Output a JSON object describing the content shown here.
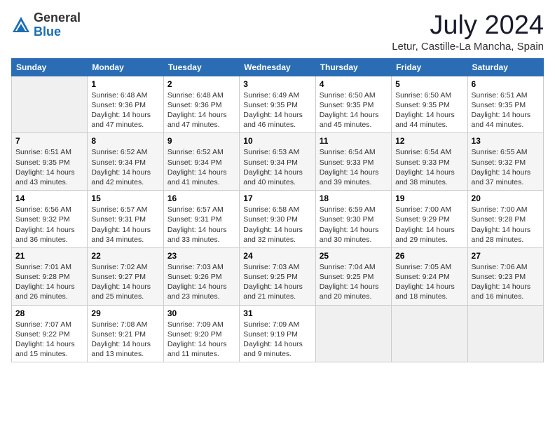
{
  "header": {
    "logo_general": "General",
    "logo_blue": "Blue",
    "month": "July 2024",
    "location": "Letur, Castille-La Mancha, Spain"
  },
  "days_of_week": [
    "Sunday",
    "Monday",
    "Tuesday",
    "Wednesday",
    "Thursday",
    "Friday",
    "Saturday"
  ],
  "weeks": [
    [
      {
        "day": "",
        "text": ""
      },
      {
        "day": "1",
        "text": "Sunrise: 6:48 AM\nSunset: 9:36 PM\nDaylight: 14 hours\nand 47 minutes."
      },
      {
        "day": "2",
        "text": "Sunrise: 6:48 AM\nSunset: 9:36 PM\nDaylight: 14 hours\nand 47 minutes."
      },
      {
        "day": "3",
        "text": "Sunrise: 6:49 AM\nSunset: 9:35 PM\nDaylight: 14 hours\nand 46 minutes."
      },
      {
        "day": "4",
        "text": "Sunrise: 6:50 AM\nSunset: 9:35 PM\nDaylight: 14 hours\nand 45 minutes."
      },
      {
        "day": "5",
        "text": "Sunrise: 6:50 AM\nSunset: 9:35 PM\nDaylight: 14 hours\nand 44 minutes."
      },
      {
        "day": "6",
        "text": "Sunrise: 6:51 AM\nSunset: 9:35 PM\nDaylight: 14 hours\nand 44 minutes."
      }
    ],
    [
      {
        "day": "7",
        "text": "Sunrise: 6:51 AM\nSunset: 9:35 PM\nDaylight: 14 hours\nand 43 minutes."
      },
      {
        "day": "8",
        "text": "Sunrise: 6:52 AM\nSunset: 9:34 PM\nDaylight: 14 hours\nand 42 minutes."
      },
      {
        "day": "9",
        "text": "Sunrise: 6:52 AM\nSunset: 9:34 PM\nDaylight: 14 hours\nand 41 minutes."
      },
      {
        "day": "10",
        "text": "Sunrise: 6:53 AM\nSunset: 9:34 PM\nDaylight: 14 hours\nand 40 minutes."
      },
      {
        "day": "11",
        "text": "Sunrise: 6:54 AM\nSunset: 9:33 PM\nDaylight: 14 hours\nand 39 minutes."
      },
      {
        "day": "12",
        "text": "Sunrise: 6:54 AM\nSunset: 9:33 PM\nDaylight: 14 hours\nand 38 minutes."
      },
      {
        "day": "13",
        "text": "Sunrise: 6:55 AM\nSunset: 9:32 PM\nDaylight: 14 hours\nand 37 minutes."
      }
    ],
    [
      {
        "day": "14",
        "text": "Sunrise: 6:56 AM\nSunset: 9:32 PM\nDaylight: 14 hours\nand 36 minutes."
      },
      {
        "day": "15",
        "text": "Sunrise: 6:57 AM\nSunset: 9:31 PM\nDaylight: 14 hours\nand 34 minutes."
      },
      {
        "day": "16",
        "text": "Sunrise: 6:57 AM\nSunset: 9:31 PM\nDaylight: 14 hours\nand 33 minutes."
      },
      {
        "day": "17",
        "text": "Sunrise: 6:58 AM\nSunset: 9:30 PM\nDaylight: 14 hours\nand 32 minutes."
      },
      {
        "day": "18",
        "text": "Sunrise: 6:59 AM\nSunset: 9:30 PM\nDaylight: 14 hours\nand 30 minutes."
      },
      {
        "day": "19",
        "text": "Sunrise: 7:00 AM\nSunset: 9:29 PM\nDaylight: 14 hours\nand 29 minutes."
      },
      {
        "day": "20",
        "text": "Sunrise: 7:00 AM\nSunset: 9:28 PM\nDaylight: 14 hours\nand 28 minutes."
      }
    ],
    [
      {
        "day": "21",
        "text": "Sunrise: 7:01 AM\nSunset: 9:28 PM\nDaylight: 14 hours\nand 26 minutes."
      },
      {
        "day": "22",
        "text": "Sunrise: 7:02 AM\nSunset: 9:27 PM\nDaylight: 14 hours\nand 25 minutes."
      },
      {
        "day": "23",
        "text": "Sunrise: 7:03 AM\nSunset: 9:26 PM\nDaylight: 14 hours\nand 23 minutes."
      },
      {
        "day": "24",
        "text": "Sunrise: 7:03 AM\nSunset: 9:25 PM\nDaylight: 14 hours\nand 21 minutes."
      },
      {
        "day": "25",
        "text": "Sunrise: 7:04 AM\nSunset: 9:25 PM\nDaylight: 14 hours\nand 20 minutes."
      },
      {
        "day": "26",
        "text": "Sunrise: 7:05 AM\nSunset: 9:24 PM\nDaylight: 14 hours\nand 18 minutes."
      },
      {
        "day": "27",
        "text": "Sunrise: 7:06 AM\nSunset: 9:23 PM\nDaylight: 14 hours\nand 16 minutes."
      }
    ],
    [
      {
        "day": "28",
        "text": "Sunrise: 7:07 AM\nSunset: 9:22 PM\nDaylight: 14 hours\nand 15 minutes."
      },
      {
        "day": "29",
        "text": "Sunrise: 7:08 AM\nSunset: 9:21 PM\nDaylight: 14 hours\nand 13 minutes."
      },
      {
        "day": "30",
        "text": "Sunrise: 7:09 AM\nSunset: 9:20 PM\nDaylight: 14 hours\nand 11 minutes."
      },
      {
        "day": "31",
        "text": "Sunrise: 7:09 AM\nSunset: 9:19 PM\nDaylight: 14 hours\nand 9 minutes."
      },
      {
        "day": "",
        "text": ""
      },
      {
        "day": "",
        "text": ""
      },
      {
        "day": "",
        "text": ""
      }
    ]
  ]
}
